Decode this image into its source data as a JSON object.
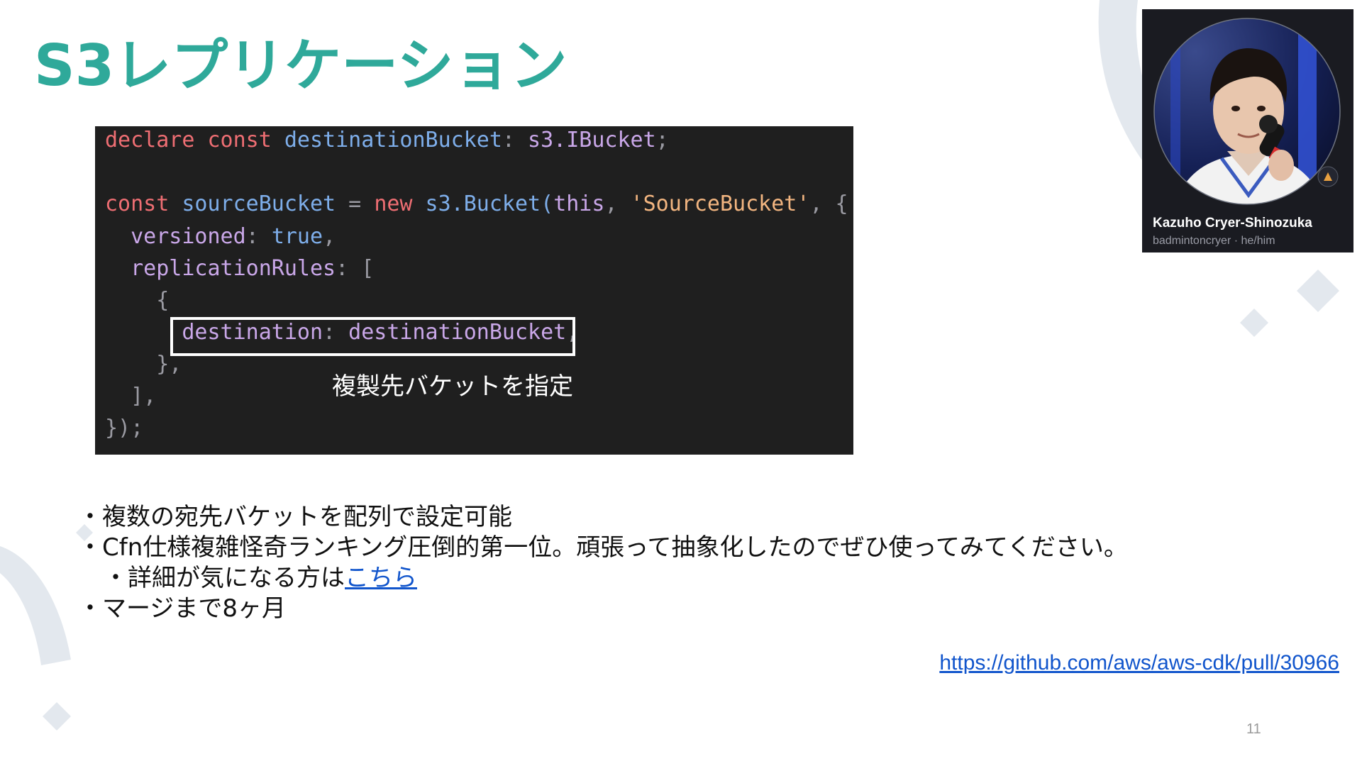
{
  "slide": {
    "title": "S3レプリケーション",
    "page_number": "11",
    "colors": {
      "title": "#2fa99a",
      "decoration": "#e3e8ee",
      "link": "#1155cc",
      "code_background": "#1f1f1f",
      "code_keyword": "#ee6e73",
      "code_identifier": "#7eaeea",
      "code_property": "#c9a7e8",
      "code_string": "#f2b580",
      "code_punctuation": "#9a9aa2"
    }
  },
  "code_block": {
    "lines": [
      [
        {
          "t": "declare",
          "k": "keyword"
        },
        {
          "t": " ",
          "k": "plain"
        },
        {
          "t": "const",
          "k": "keyword"
        },
        {
          "t": " destinationBucket",
          "k": "identifier"
        },
        {
          "t": ": ",
          "k": "punct"
        },
        {
          "t": "s3.IBucket",
          "k": "property"
        },
        {
          "t": ";",
          "k": "punct"
        }
      ],
      [],
      [
        {
          "t": "const",
          "k": "keyword"
        },
        {
          "t": " sourceBucket",
          "k": "identifier"
        },
        {
          "t": " = ",
          "k": "punct"
        },
        {
          "t": "new",
          "k": "keyword"
        },
        {
          "t": " s3.Bucket(",
          "k": "identifier"
        },
        {
          "t": "this",
          "k": "property"
        },
        {
          "t": ", ",
          "k": "punct"
        },
        {
          "t": "'SourceBucket'",
          "k": "string"
        },
        {
          "t": ", {",
          "k": "punct"
        }
      ],
      [
        {
          "t": "  versioned",
          "k": "property"
        },
        {
          "t": ": ",
          "k": "punct"
        },
        {
          "t": "true",
          "k": "identifier"
        },
        {
          "t": ",",
          "k": "punct"
        }
      ],
      [
        {
          "t": "  replicationRules",
          "k": "property"
        },
        {
          "t": ": [",
          "k": "punct"
        }
      ],
      [
        {
          "t": "    {",
          "k": "punct"
        }
      ],
      [
        {
          "t": "      destination",
          "k": "property"
        },
        {
          "t": ": ",
          "k": "punct"
        },
        {
          "t": "destinationBucket",
          "k": "property"
        },
        {
          "t": ",",
          "k": "punct"
        }
      ],
      [
        {
          "t": "    },",
          "k": "punct"
        }
      ],
      [
        {
          "t": "  ],",
          "k": "punct"
        }
      ],
      [
        {
          "t": "});",
          "k": "punct"
        }
      ]
    ],
    "caption": "複製先バケットを指定"
  },
  "speaker": {
    "name": "Kazuho Cryer-Shinozuka",
    "handle": "badmintoncryer · he/him"
  },
  "bullets": [
    {
      "text": "・複数の宛先バケットを配列で設定可能"
    },
    {
      "text": "・Cfn仕様複雑怪奇ランキング圧倒的第一位。頑張って抽象化したのでぜひ使ってみてください。"
    },
    {
      "text": "・詳細が気になる方は",
      "link_text": "こちら",
      "sub": true
    },
    {
      "text": "・マージまで8ヶ月"
    }
  ],
  "source_link": "https://github.com/aws/aws-cdk/pull/30966"
}
